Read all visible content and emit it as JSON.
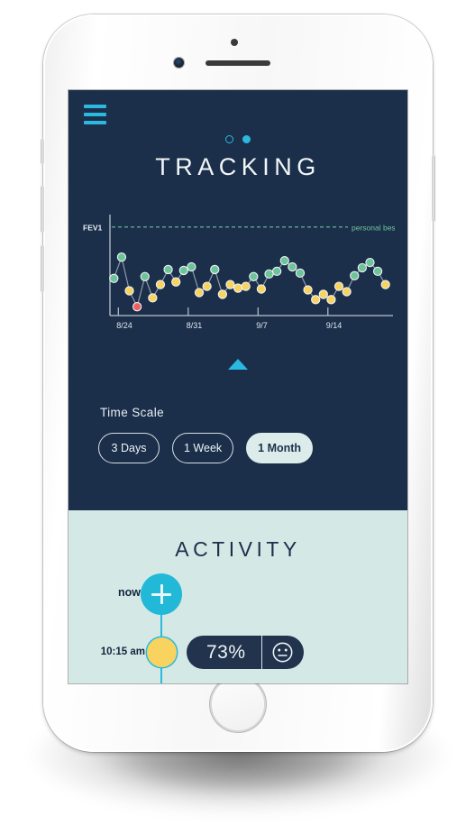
{
  "device": {
    "type": "smartphone-mockup",
    "frame_color": "#f3f3f3"
  },
  "screen": {
    "background": "#1b2f4b",
    "accent": "#2bb9e0"
  },
  "tracking": {
    "menu_icon": "hamburger-menu-icon",
    "title": "TRACKING",
    "pager": {
      "dots": [
        {
          "state": "inactive"
        },
        {
          "state": "active"
        }
      ]
    },
    "time_scale": {
      "label": "Time Scale",
      "options": [
        {
          "label": "3 Days",
          "selected": false
        },
        {
          "label": "1 Week",
          "selected": false
        },
        {
          "label": "1 Month",
          "selected": true
        }
      ]
    },
    "scroll_indicator_icon": "triangle-up-icon"
  },
  "chart_data": {
    "type": "line",
    "title": "",
    "ylabel": "FEV1",
    "xlabel": "",
    "grid": false,
    "legend_position": "none",
    "annotations": [
      {
        "text": "personal best",
        "type": "threshold-line",
        "style": "dashed",
        "color": "#6ec49a",
        "y": 100
      }
    ],
    "axis_tick_labels": [
      "8/24",
      "8/31",
      "9/7",
      "9/14"
    ],
    "tick_x_fractions": [
      0.03,
      0.28,
      0.53,
      0.78
    ],
    "colors": {
      "green": "#6ec49a",
      "yellow": "#f8d35f",
      "red": "#ef5f5f",
      "line": "#8e9aa8",
      "axis": "#b9c3cc",
      "personal_best": "#6ec49a"
    },
    "series": [
      {
        "name": "FEV1 daily reading",
        "values": [
          {
            "x": 0,
            "y": 42,
            "zone": "green"
          },
          {
            "x": 1,
            "y": 66,
            "zone": "green"
          },
          {
            "x": 2,
            "y": 28,
            "zone": "yellow"
          },
          {
            "x": 3,
            "y": 10,
            "zone": "red"
          },
          {
            "x": 4,
            "y": 44,
            "zone": "green"
          },
          {
            "x": 5,
            "y": 20,
            "zone": "yellow"
          },
          {
            "x": 6,
            "y": 35,
            "zone": "yellow"
          },
          {
            "x": 7,
            "y": 52,
            "zone": "green"
          },
          {
            "x": 8,
            "y": 38,
            "zone": "yellow"
          },
          {
            "x": 9,
            "y": 51,
            "zone": "green"
          },
          {
            "x": 10,
            "y": 55,
            "zone": "green"
          },
          {
            "x": 11,
            "y": 26,
            "zone": "yellow"
          },
          {
            "x": 12,
            "y": 33,
            "zone": "yellow"
          },
          {
            "x": 13,
            "y": 52,
            "zone": "green"
          },
          {
            "x": 14,
            "y": 24,
            "zone": "yellow"
          },
          {
            "x": 15,
            "y": 35,
            "zone": "yellow"
          },
          {
            "x": 16,
            "y": 31,
            "zone": "yellow"
          },
          {
            "x": 17,
            "y": 33,
            "zone": "yellow"
          },
          {
            "x": 18,
            "y": 44,
            "zone": "green"
          },
          {
            "x": 19,
            "y": 30,
            "zone": "yellow"
          },
          {
            "x": 20,
            "y": 47,
            "zone": "green"
          },
          {
            "x": 21,
            "y": 50,
            "zone": "green"
          },
          {
            "x": 22,
            "y": 62,
            "zone": "green"
          },
          {
            "x": 23,
            "y": 55,
            "zone": "green"
          },
          {
            "x": 24,
            "y": 48,
            "zone": "green"
          },
          {
            "x": 25,
            "y": 29,
            "zone": "yellow"
          },
          {
            "x": 26,
            "y": 18,
            "zone": "yellow"
          },
          {
            "x": 27,
            "y": 24,
            "zone": "yellow"
          },
          {
            "x": 28,
            "y": 18,
            "zone": "yellow"
          },
          {
            "x": 29,
            "y": 33,
            "zone": "yellow"
          },
          {
            "x": 30,
            "y": 27,
            "zone": "yellow"
          },
          {
            "x": 31,
            "y": 45,
            "zone": "green"
          },
          {
            "x": 32,
            "y": 54,
            "zone": "green"
          },
          {
            "x": 33,
            "y": 60,
            "zone": "green"
          },
          {
            "x": 34,
            "y": 50,
            "zone": "green"
          },
          {
            "x": 35,
            "y": 35,
            "zone": "yellow"
          }
        ]
      }
    ],
    "ylim": [
      0,
      110
    ],
    "xlim": [
      -0.5,
      35.5
    ]
  },
  "activity": {
    "title": "ACTIVITY",
    "entries": [
      {
        "time_label": "now",
        "marker": "add-button",
        "action_icon": "plus-icon",
        "marker_color": "#22b8d8"
      },
      {
        "time_label": "10:15 am",
        "marker": "reading-dot",
        "marker_color": "#f8d35f",
        "value": "73%",
        "mood_icon": "neutral-face-icon"
      }
    ]
  }
}
